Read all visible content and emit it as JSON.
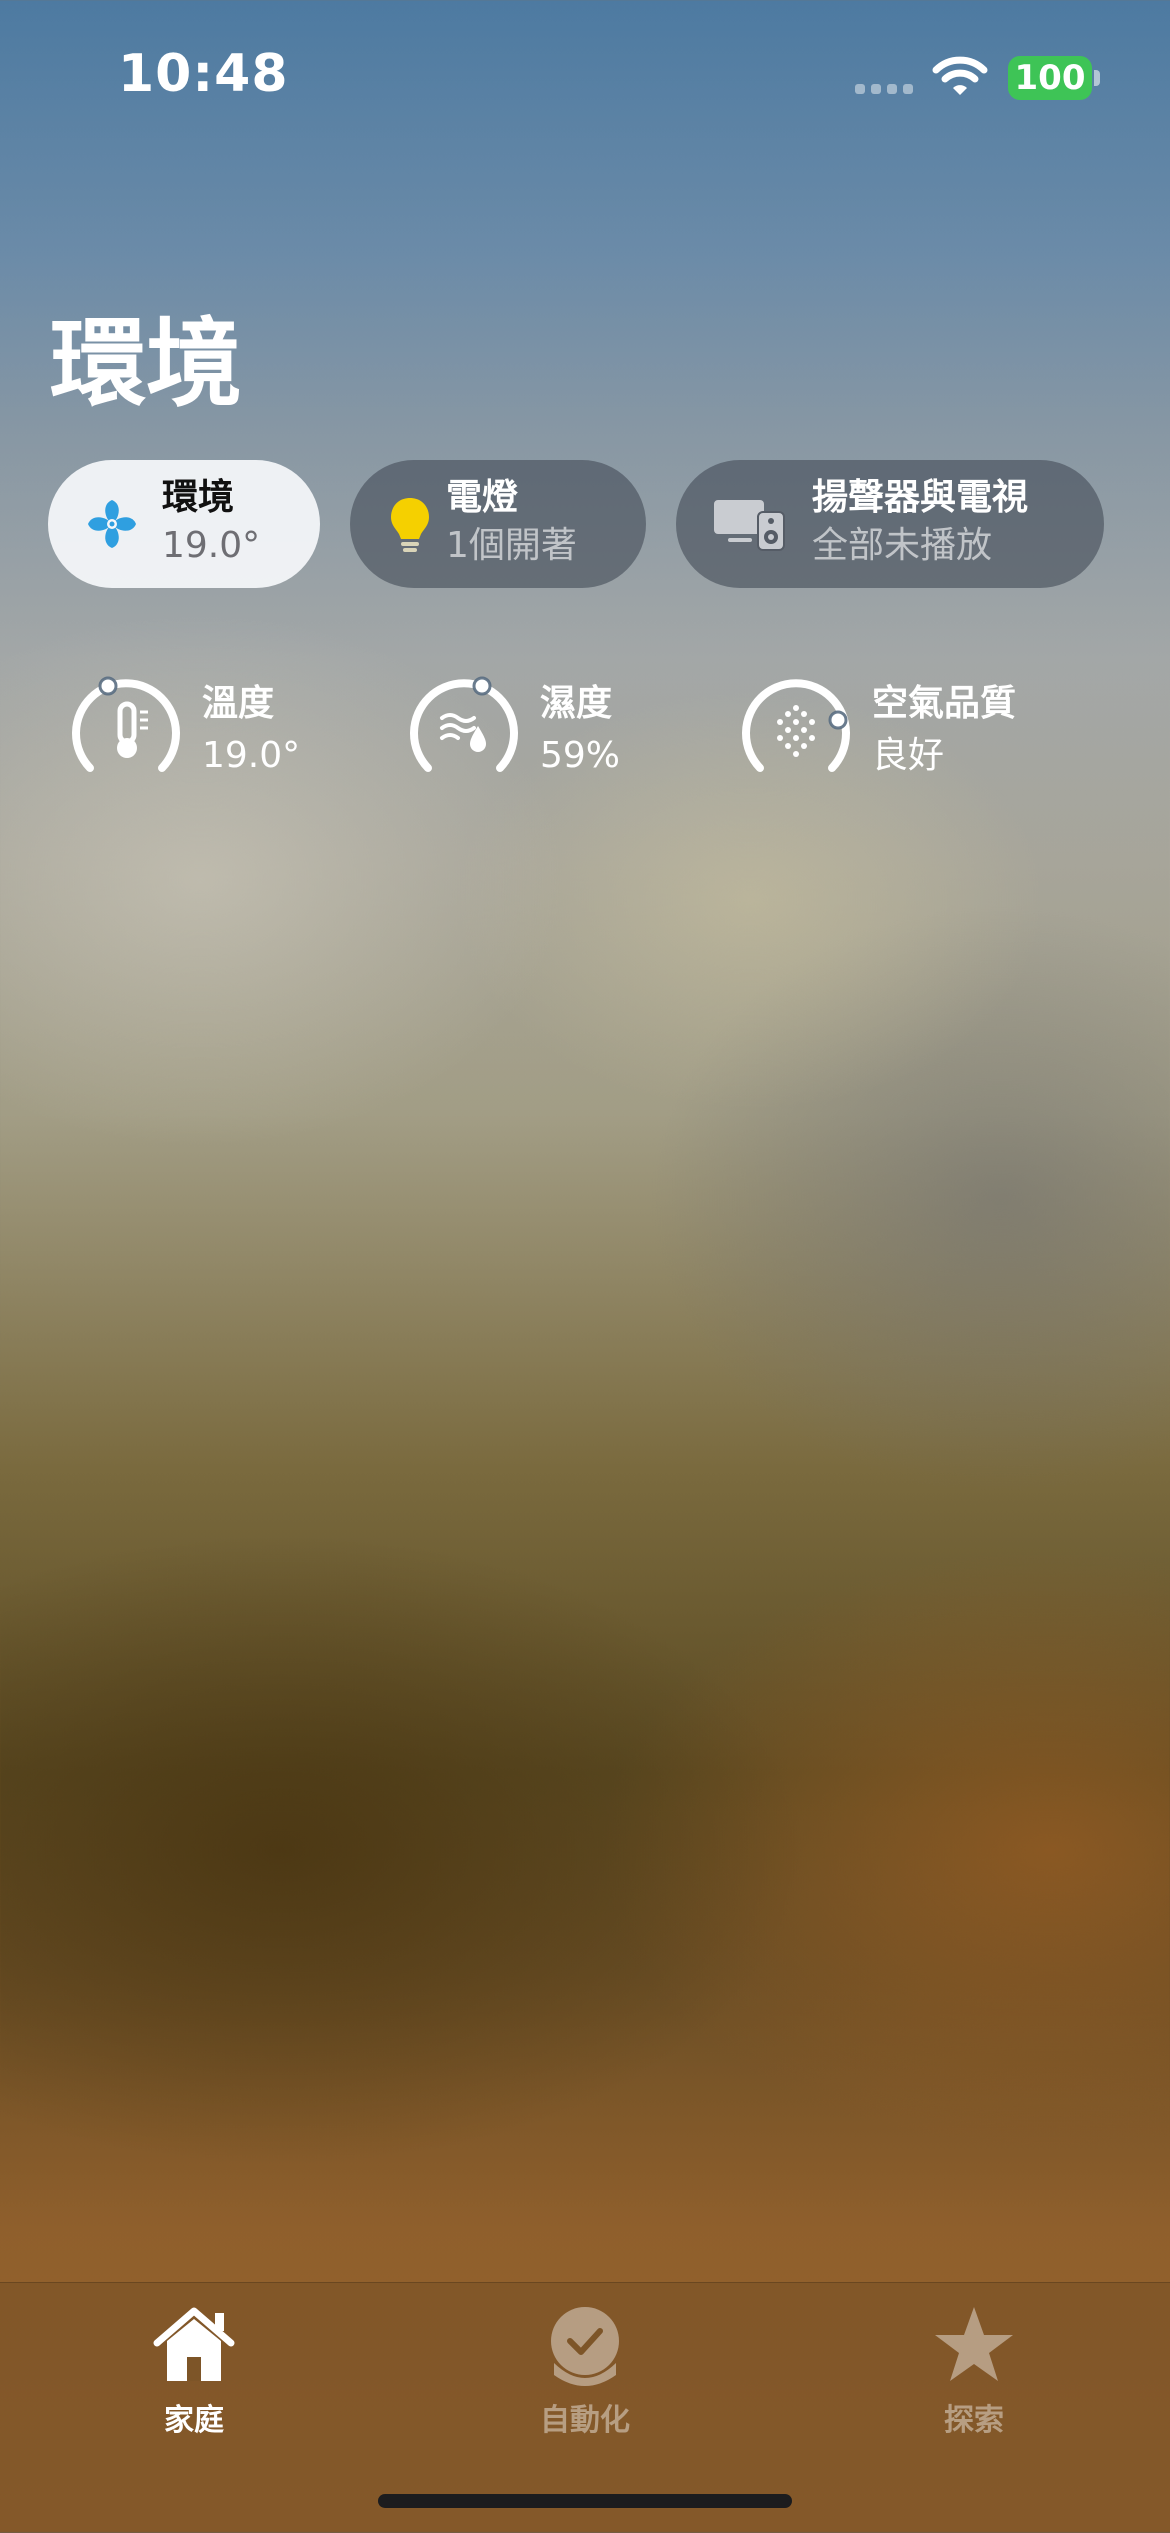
{
  "status_bar": {
    "time": "10:48",
    "battery": "100"
  },
  "page": {
    "title": "環境"
  },
  "chips": [
    {
      "title": "環境",
      "subtitle": "19.0°"
    },
    {
      "title": "電燈",
      "subtitle": "1個開著"
    },
    {
      "title": "揚聲器與電視",
      "subtitle": "全部未播放"
    }
  ],
  "sensors": [
    {
      "label": "溫度",
      "value": "19.0°"
    },
    {
      "label": "濕度",
      "value": "59%"
    },
    {
      "label": "空氣品質",
      "value": "良好"
    }
  ],
  "tabs": [
    {
      "label": "家庭"
    },
    {
      "label": "自動化"
    },
    {
      "label": "探索"
    }
  ],
  "colors": {
    "fan_blue": "#2f9fe0",
    "bulb_yellow": "#f5d000",
    "battery_green": "#3ec456"
  }
}
